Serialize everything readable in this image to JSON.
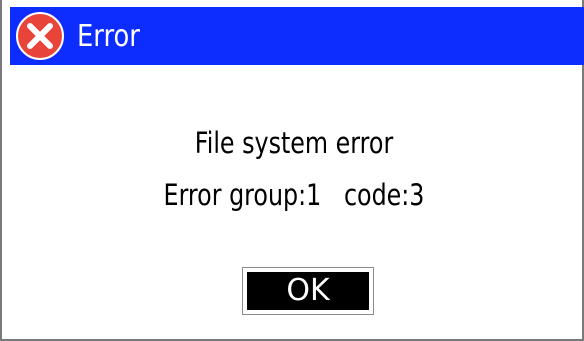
{
  "window": {
    "title": "Error",
    "icon": "error-x-icon",
    "title_bar_color": "#0d2dff"
  },
  "message": {
    "line1": "File system error",
    "line2": "Error group:1   code:3"
  },
  "buttons": {
    "ok_label": "OK"
  },
  "colors": {
    "icon_red": "#e8443a",
    "button_bg": "#000000",
    "button_text": "#ffffff"
  }
}
